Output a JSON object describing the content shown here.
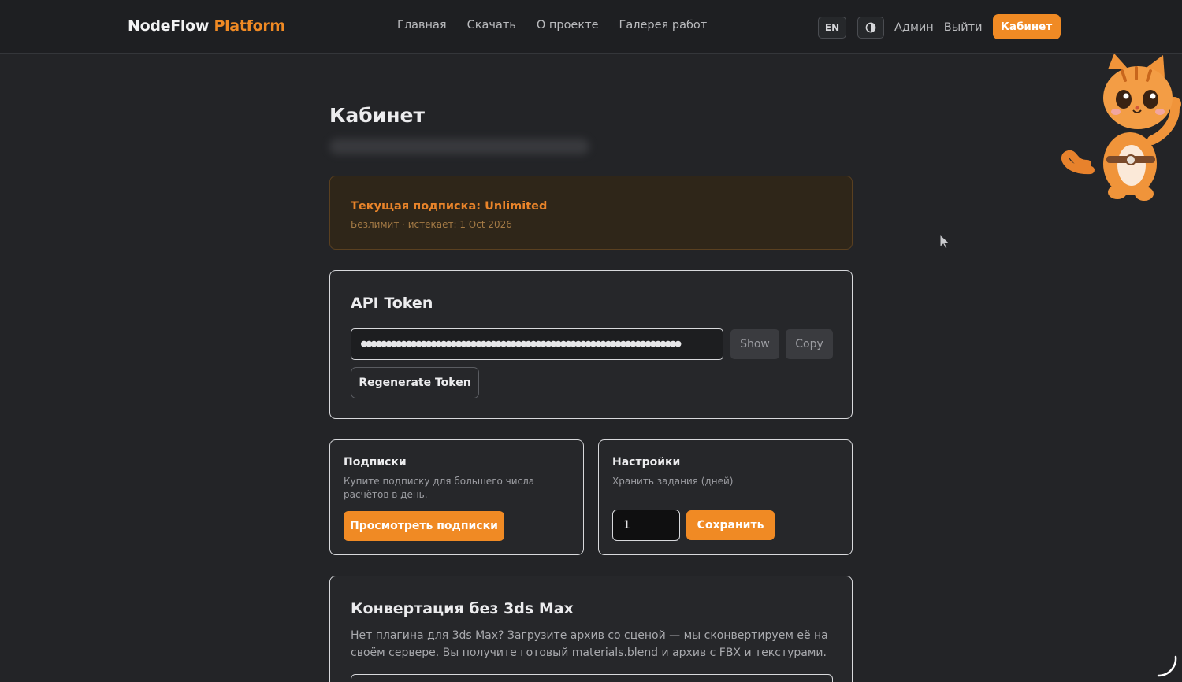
{
  "header": {
    "brand_main": "NodeFlow",
    "brand_accent": "Platform",
    "nav": [
      "Главная",
      "Скачать",
      "О проекте",
      "Галерея работ"
    ],
    "lang": "EN",
    "admin": "Админ",
    "logout": "Выйти",
    "cabinet": "Кабинет"
  },
  "page": {
    "title": "Кабинет"
  },
  "subscription": {
    "title": "Текущая подписка: Unlimited",
    "meta": "Безлимит · истекает: 1 Oct 2026"
  },
  "api": {
    "title": "API Token",
    "token_masked": "●●●●●●●●●●●●●●●●●●●●●●●●●●●●●●●●●●●●●●●●●●●●●●●●●●●●●●●●●●●●●●●●",
    "show": "Show",
    "copy": "Copy",
    "regenerate": "Regenerate Token"
  },
  "subs": {
    "title": "Подписки",
    "desc": "Купите подписку для большего числа расчётов в день.",
    "button": "Просмотреть подписки"
  },
  "settings": {
    "title": "Настройки",
    "desc": "Хранить задания (дней)",
    "days_value": "1",
    "save": "Сохранить"
  },
  "convert": {
    "title": "Конвертация без 3ds Max",
    "desc": "Нет плагина для 3ds Max? Загрузите архив со сценой — мы сконвертируем её на своём сервере. Вы получите готовый materials.blend и архив с FBX и текстурами."
  },
  "colors": {
    "accent": "#f08a24",
    "background": "#232427",
    "header": "#1e1f22"
  }
}
